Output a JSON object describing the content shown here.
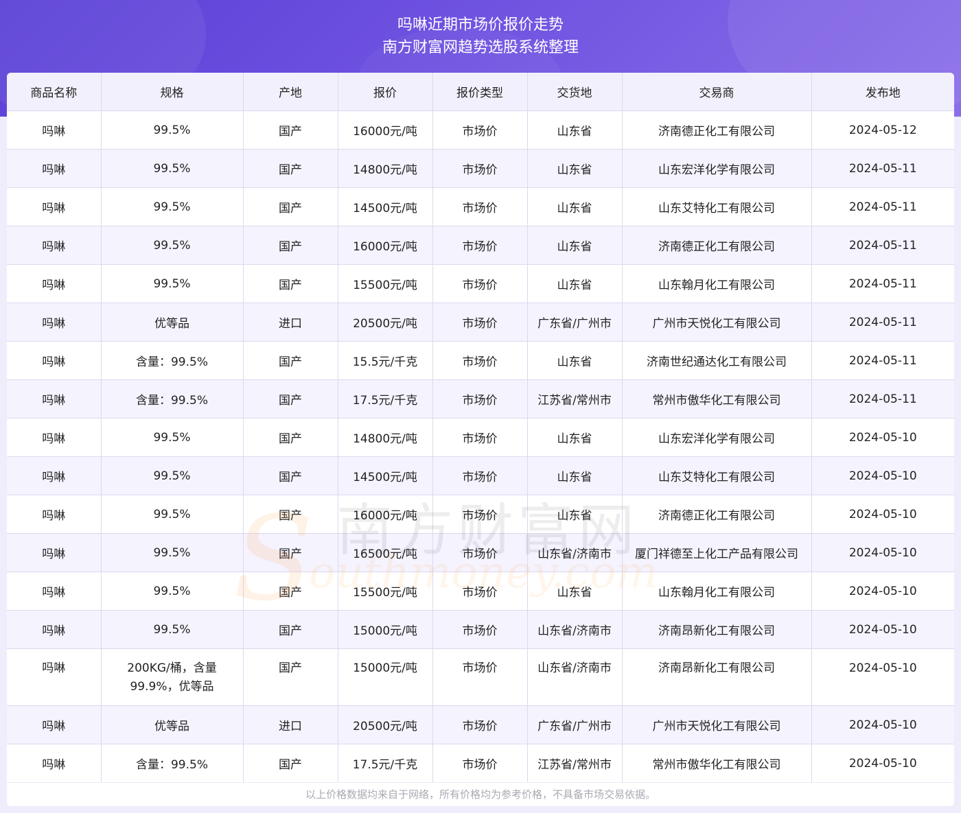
{
  "header": {
    "title": "吗啉近期市场价报价走势",
    "subtitle": "南方财富网趋势选股系统整理"
  },
  "columns": [
    "商品名称",
    "规格",
    "产地",
    "报价",
    "报价类型",
    "交货地",
    "交易商",
    "发布地"
  ],
  "rows": [
    [
      "吗啉",
      "99.5%",
      "国产",
      "16000元/吨",
      "市场价",
      "山东省",
      "济南德正化工有限公司",
      "2024-05-12"
    ],
    [
      "吗啉",
      "99.5%",
      "国产",
      "14800元/吨",
      "市场价",
      "山东省",
      "山东宏洋化学有限公司",
      "2024-05-11"
    ],
    [
      "吗啉",
      "99.5%",
      "国产",
      "14500元/吨",
      "市场价",
      "山东省",
      "山东艾特化工有限公司",
      "2024-05-11"
    ],
    [
      "吗啉",
      "99.5%",
      "国产",
      "16000元/吨",
      "市场价",
      "山东省",
      "济南德正化工有限公司",
      "2024-05-11"
    ],
    [
      "吗啉",
      "99.5%",
      "国产",
      "15500元/吨",
      "市场价",
      "山东省",
      "山东翰月化工有限公司",
      "2024-05-11"
    ],
    [
      "吗啉",
      "优等品",
      "进口",
      "20500元/吨",
      "市场价",
      "广东省/广州市",
      "广州市天悦化工有限公司",
      "2024-05-11"
    ],
    [
      "吗啉",
      "含量：99.5%",
      "国产",
      "15.5元/千克",
      "市场价",
      "山东省",
      "济南世纪通达化工有限公司",
      "2024-05-11"
    ],
    [
      "吗啉",
      "含量：99.5%",
      "国产",
      "17.5元/千克",
      "市场价",
      "江苏省/常州市",
      "常州市傲华化工有限公司",
      "2024-05-11"
    ],
    [
      "吗啉",
      "99.5%",
      "国产",
      "14800元/吨",
      "市场价",
      "山东省",
      "山东宏洋化学有限公司",
      "2024-05-10"
    ],
    [
      "吗啉",
      "99.5%",
      "国产",
      "14500元/吨",
      "市场价",
      "山东省",
      "山东艾特化工有限公司",
      "2024-05-10"
    ],
    [
      "吗啉",
      "99.5%",
      "国产",
      "16000元/吨",
      "市场价",
      "山东省",
      "济南德正化工有限公司",
      "2024-05-10"
    ],
    [
      "吗啉",
      "99.5%",
      "国产",
      "16500元/吨",
      "市场价",
      "山东省/济南市",
      "厦门祥德至上化工产品有限公司",
      "2024-05-10"
    ],
    [
      "吗啉",
      "99.5%",
      "国产",
      "15500元/吨",
      "市场价",
      "山东省",
      "山东翰月化工有限公司",
      "2024-05-10"
    ],
    [
      "吗啉",
      "99.5%",
      "国产",
      "15000元/吨",
      "市场价",
      "山东省/济南市",
      "济南昂新化工有限公司",
      "2024-05-10"
    ],
    [
      "吗啉",
      "200KG/桶，含量99.9%，优等品",
      "国产",
      "15000元/吨",
      "市场价",
      "山东省/济南市",
      "济南昂新化工有限公司",
      "2024-05-10"
    ],
    [
      "吗啉",
      "优等品",
      "进口",
      "20500元/吨",
      "市场价",
      "广东省/广州市",
      "广州市天悦化工有限公司",
      "2024-05-10"
    ],
    [
      "吗啉",
      "含量：99.5%",
      "国产",
      "17.5元/千克",
      "市场价",
      "江苏省/常州市",
      "常州市傲华化工有限公司",
      "2024-05-10"
    ]
  ],
  "footer": "以上价格数据均来自于网络，所有价格均为参考价格，不具备市场交易依据。",
  "watermark": {
    "cn": "南方财富网",
    "en": "outhmoney.com",
    "logo_letter": "S"
  },
  "colors": {
    "header_gradient_start": "#5a3fd6",
    "header_gradient_end": "#8a6ee9",
    "table_header_bg": "#f3f0fd",
    "row_alt_bg": "#f5f3fe"
  }
}
